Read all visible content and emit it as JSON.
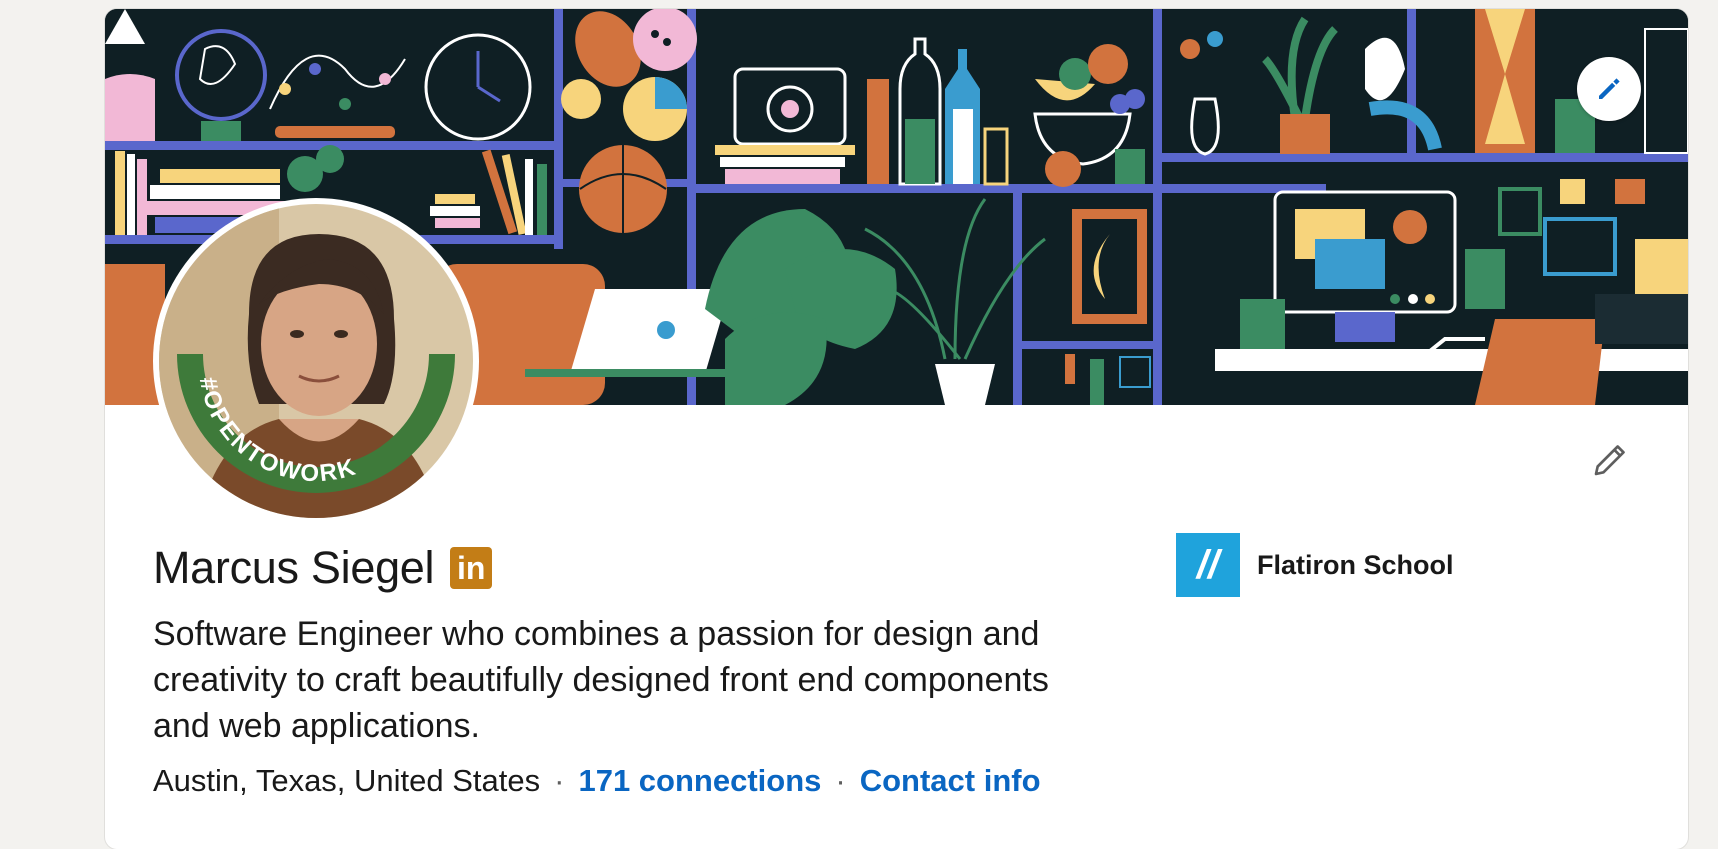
{
  "profile": {
    "name": "Marcus Siegel",
    "badge_text": "in",
    "headline": "Software Engineer who combines a passion for design and creativity to craft beautifully designed front end components and web applications.",
    "location": "Austin, Texas, United States",
    "connections": "171 connections",
    "contact": "Contact info",
    "separator": "·",
    "open_to_work_frame": "#OPENTOWORK"
  },
  "education": {
    "school_name": "Flatiron School",
    "logo_text": "//"
  },
  "icons": {
    "banner_edit": "pencil-icon",
    "intro_edit": "pencil-outline-icon"
  },
  "colors": {
    "link": "#0a66c2",
    "badge": "#c37d16",
    "open_to_work": "#3e7a3a",
    "school_logo": "#1fa3dc"
  }
}
